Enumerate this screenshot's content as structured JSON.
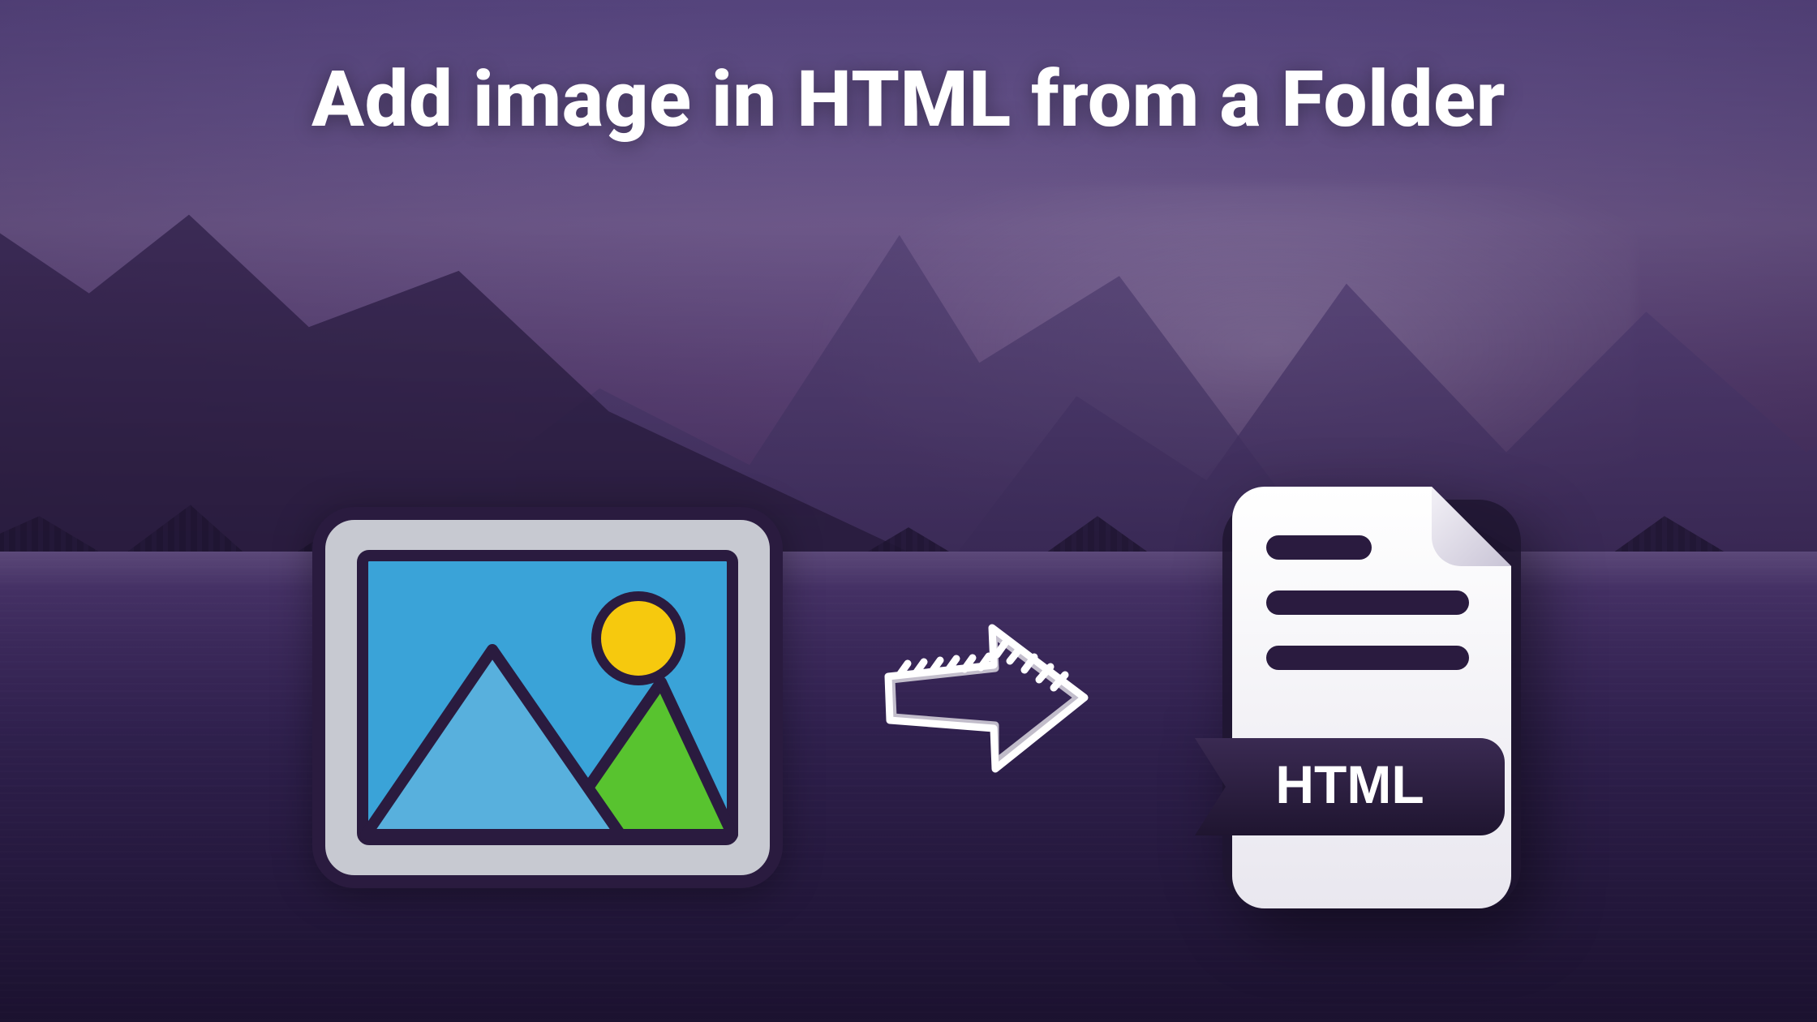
{
  "headline": "Add image in HTML from a Folder",
  "file_badge": "HTML",
  "icons": {
    "picture": "picture-frame-icon",
    "arrow": "arrow-right-icon",
    "file": "html-file-icon"
  },
  "colors": {
    "headline": "#ffffff",
    "file_badge_bg": "#2a1b3f",
    "file_badge_text": "#ffffff",
    "picture_sky": "#3aa3d8",
    "picture_mountain1": "#58b0dd",
    "picture_mountain2": "#58c32f",
    "picture_sun": "#f6c90e",
    "picture_frame": "#c7c9d1",
    "picture_outline": "#2a1b3f",
    "arrow_stroke": "#ffffff"
  }
}
